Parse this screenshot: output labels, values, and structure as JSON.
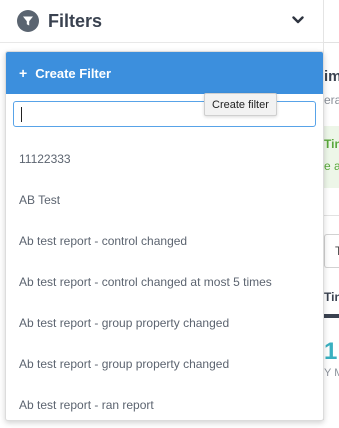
{
  "header": {
    "title": "Filters",
    "icon": "filter-icon",
    "chevron_icon": "chevron-down-icon"
  },
  "dropdown": {
    "create_button": {
      "plus": "+",
      "label": "Create Filter"
    },
    "search": {
      "value": "",
      "placeholder": ""
    },
    "items": [
      "11122333",
      "AB Test",
      "Ab test report - control changed",
      "Ab test report - control changed at most 5 times",
      "Ab test report - group property changed",
      "Ab test report - group property changed",
      "Ab test report - ran report"
    ]
  },
  "tooltip": {
    "text": "Create filter"
  },
  "background_panel": {
    "fragment_1": "im",
    "fragment_2": "era",
    "fragment_3": "Tin",
    "fragment_4": "e a",
    "fragment_5": "T",
    "fragment_6": "Tin",
    "fragment_7": "1.",
    "fragment_8": "Y M"
  },
  "colors": {
    "accent": "#3c8fdd",
    "header_text": "#3a4250",
    "list_text": "#5c6470",
    "green_text": "#5aa83c",
    "teal_number": "#3ab0c0"
  }
}
